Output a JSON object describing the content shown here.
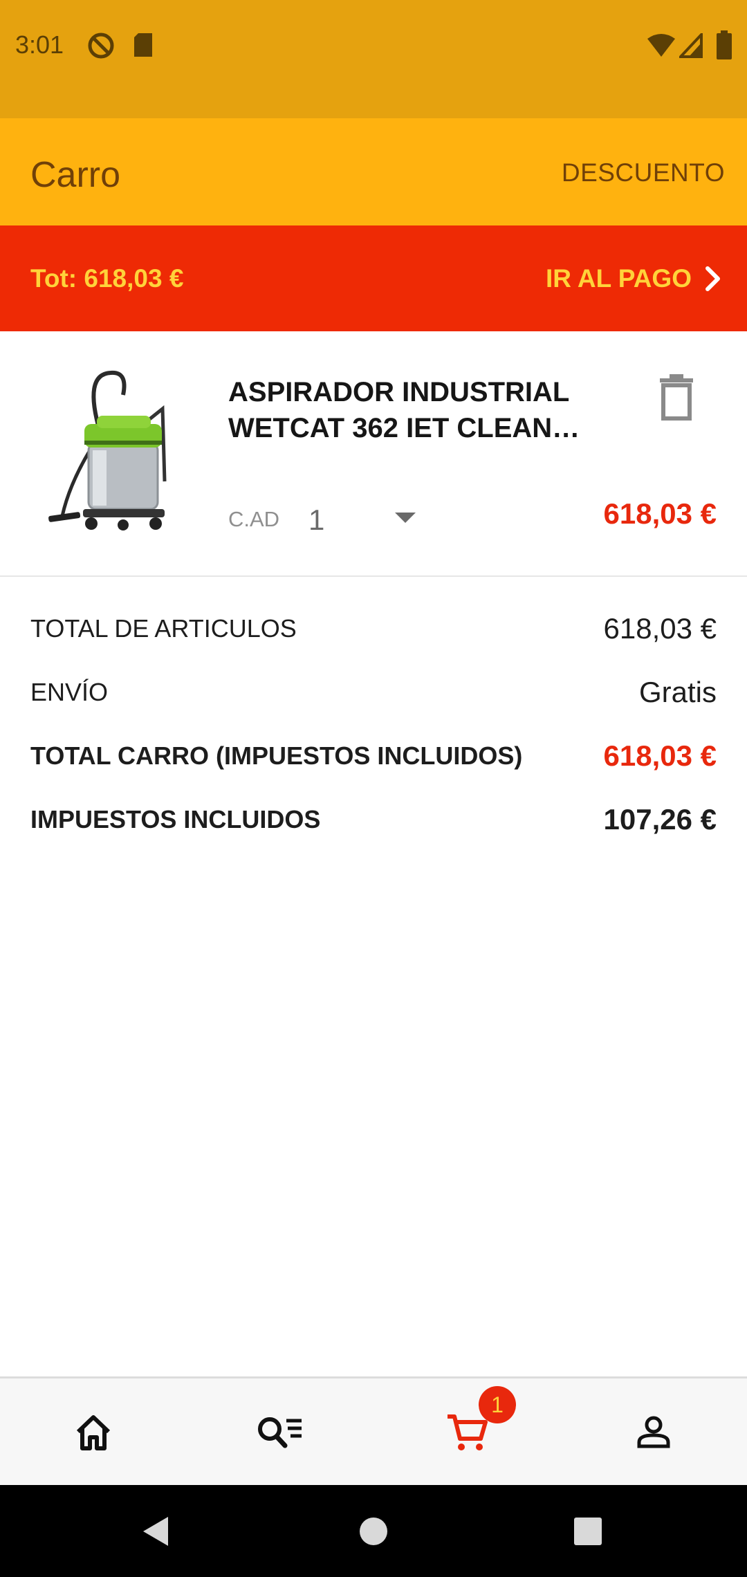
{
  "status_bar": {
    "time": "3:01",
    "icons": [
      "at-sign-icon",
      "sd-card-icon",
      "wifi-icon",
      "signal-icon",
      "battery-icon"
    ]
  },
  "app_bar": {
    "title": "Carro",
    "action": "DESCUENTO"
  },
  "total_bar": {
    "total": "Tot: 618,03 €",
    "pay_label": "IR AL PAGO"
  },
  "cart_item": {
    "name": "ASPIRADOR INDUSTRIAL WETCAT 362 IET CLEAN…",
    "quantity_label": "C.AD",
    "quantity": "1",
    "price": "618,03 €",
    "image": "industrial-vacuum-cleaner"
  },
  "summary": {
    "items_total_label": "TOTAL DE ARTICULOS",
    "items_total_value": "618,03 €",
    "shipping_label": "ENVÍO",
    "shipping_value": "Gratis",
    "cart_total_label": "TOTAL CARRO (IMPUESTOS INCLUIDOS)",
    "cart_total_value": "618,03 €",
    "tax_label": "IMPUESTOS INCLUIDOS",
    "tax_value": "107,26 €"
  },
  "bottom_nav": {
    "items": [
      "home-icon",
      "search-list-icon",
      "cart-icon",
      "account-icon"
    ],
    "active": "cart-icon",
    "cart_badge": "1"
  },
  "colors": {
    "status_bar": "#e5a20f",
    "app_bar": "#ffb20f",
    "total_bar": "#ee2a05",
    "accent_text": "#ffd33a",
    "price_red": "#e8280d"
  }
}
